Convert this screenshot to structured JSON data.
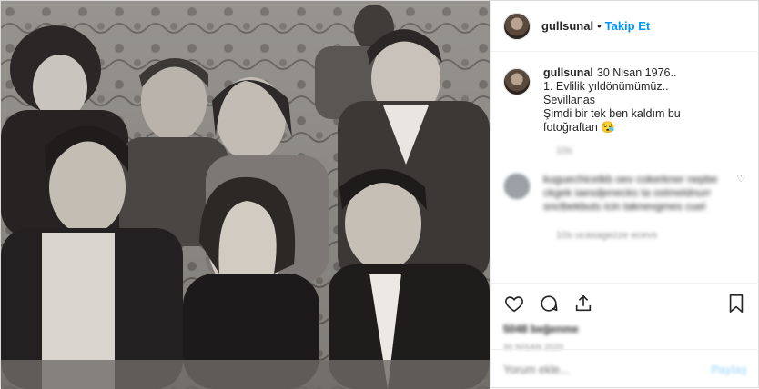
{
  "user": {
    "username": "gullsunal",
    "separator": "•",
    "follow_label": "Takip Et"
  },
  "caption": {
    "username": "gullsunal",
    "lines": [
      "30 Nisan 1976..",
      "1. Evlilik yıldönümümüz..",
      "Sevillanas",
      "Şimdi bir tek ben kaldım bu",
      "fotoğraftan 😪"
    ],
    "age": "10s"
  },
  "comment": {
    "text": "kuguechicelkb oev cokerkner nepbe ckgek iaesdjenecks ta ostmeldnurr snclbekbuts icin taknevgmes cuel",
    "meta": "10s  ucasagezze  ecevs",
    "heart": "♡"
  },
  "actions": {
    "like": "heart-icon",
    "comment": "comment-icon",
    "share": "share-icon",
    "save": "bookmark-icon"
  },
  "likes_text": "5048 beğenme",
  "date_text": "30 NİSAN 2020",
  "add_comment": {
    "placeholder": "Yorum ekle...",
    "post_label": "Paylaş"
  }
}
